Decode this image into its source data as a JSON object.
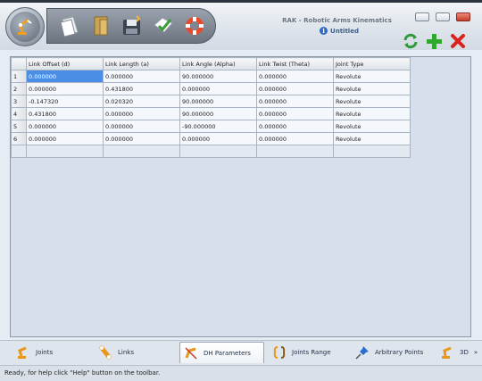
{
  "app": {
    "title": "RAK - Robotic Arms Kinematics",
    "document": "Untitled"
  },
  "toolbar": {
    "items": [
      {
        "icon": "new-document-icon"
      },
      {
        "icon": "open-folder-icon"
      },
      {
        "icon": "save-disk-icon"
      },
      {
        "icon": "check-apply-icon"
      },
      {
        "icon": "lifebuoy-help-icon"
      }
    ]
  },
  "actions": {
    "refresh_icon": "refresh-icon",
    "add_icon": "plus-icon",
    "delete_icon": "x-delete-icon"
  },
  "grid": {
    "columns": [
      "Link Offset (d)",
      "Link Length (a)",
      "Link Angle (Alpha)",
      "Link Twist (Theta)",
      "Joint Type"
    ],
    "rows": [
      {
        "num": "1",
        "cells": [
          "0.000000",
          "0.000000",
          "90.000000",
          "0.000000",
          "Revolute"
        ]
      },
      {
        "num": "2",
        "cells": [
          "0.000000",
          "0.431800",
          "0.000000",
          "0.000000",
          "Revolute"
        ]
      },
      {
        "num": "3",
        "cells": [
          "-0.147320",
          "0.020320",
          "90.000000",
          "0.000000",
          "Revolute"
        ]
      },
      {
        "num": "4",
        "cells": [
          "0.431800",
          "0.000000",
          "90.000000",
          "0.000000",
          "Revolute"
        ]
      },
      {
        "num": "5",
        "cells": [
          "0.000000",
          "0.000000",
          "-90.000000",
          "0.000000",
          "Revolute"
        ]
      },
      {
        "num": "6",
        "cells": [
          "0.000000",
          "0.000000",
          "0.000000",
          "0.000000",
          "Revolute"
        ]
      }
    ]
  },
  "tabs": [
    {
      "label": "Joints",
      "icon": "joints-icon"
    },
    {
      "label": "Links",
      "icon": "links-icon"
    },
    {
      "label": "DH Parameters",
      "icon": "dh-parameters-icon"
    },
    {
      "label": "Joints Range",
      "icon": "joints-range-icon"
    },
    {
      "label": "Arbitrary Points",
      "icon": "pushpin-icon"
    },
    {
      "label": "3D",
      "icon": "3d-arm-icon"
    }
  ],
  "tab_overflow": "»",
  "status": "Ready, for help click \"Help\" button on the toolbar.",
  "colors": {
    "selection": "#4b8ee6",
    "add": "#2ea82e",
    "delete": "#d8241c",
    "refresh": "#2e9a3a"
  }
}
